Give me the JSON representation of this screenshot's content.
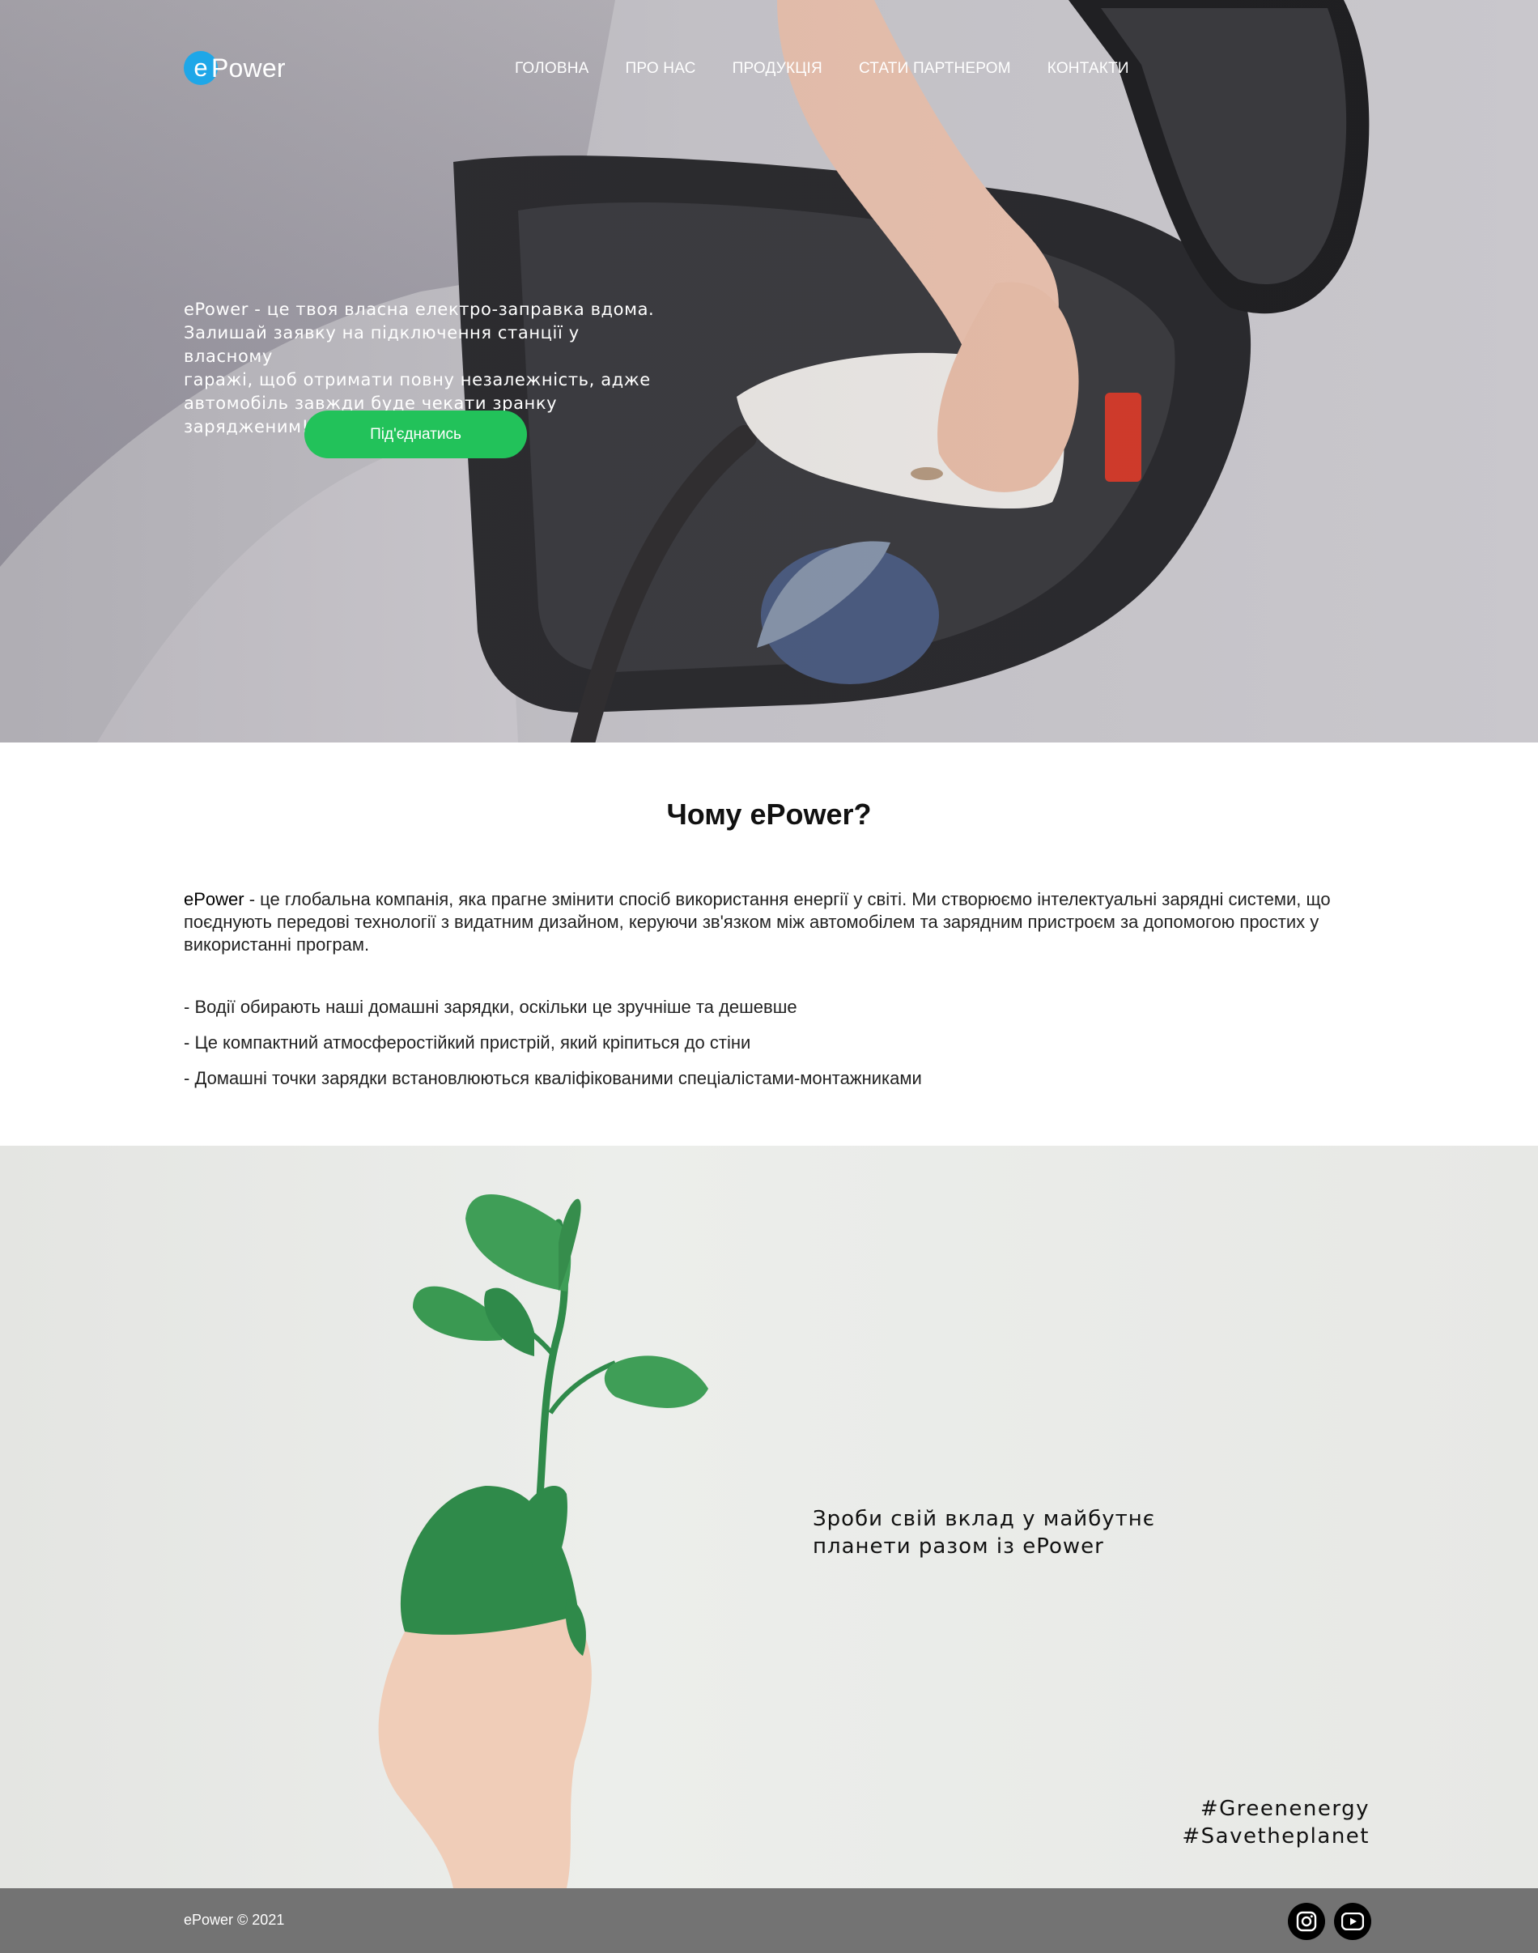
{
  "header": {
    "logo_letter": "e",
    "logo_text": "Power",
    "nav": [
      "ГОЛОВНА",
      "ПРО НАС",
      "ПРОДУКЦІЯ",
      "СТАТИ ПАРТНЕРОМ",
      "КОНТАКТИ"
    ]
  },
  "hero": {
    "lines": [
      "ePower - це твоя власна електро-заправка вдома.",
      "Залишай заявку на підключення станції у власному",
      "гаражі, щоб отримати повну незалежність, адже",
      "автомобіль завжди буде чекати зранку зарядженим!"
    ],
    "cta_label": "Під'єднатись"
  },
  "why": {
    "title": "Чому ePower?",
    "brand": "ePower",
    "paragraph_rest": " - це глобальна компанія, яка прагне змінити спосіб використання енергії у світі. Ми створюємо інтелектуальні зарядні системи, що поєднують передові технології з видатним дизайном, керуючи зв'язком між автомобілем та зарядним пристроєм за допомогою простих у використанні програм.",
    "bullets": [
      "- Водії обирають наші домашні зарядки, оскільки це зручніше та дешевше",
      "- Це компактний атмосферостійкий пристрій, який кріпиться до стіни",
      "- Домашні точки зарядки встановлюються кваліфікованими спеціалістами-монтажниками"
    ]
  },
  "planet": {
    "lines": [
      "Зроби свій вклад у майбутнє",
      "планети разом із ePower"
    ],
    "tags": [
      "#Greenenergy",
      "#Savetheplanet"
    ]
  },
  "footer": {
    "copyright": "ePower © 2021",
    "icons": [
      "instagram-icon",
      "youtube-icon"
    ]
  },
  "colors": {
    "accent": "#22c25a",
    "logo": "#1ea7e8",
    "footer": "#737373"
  }
}
